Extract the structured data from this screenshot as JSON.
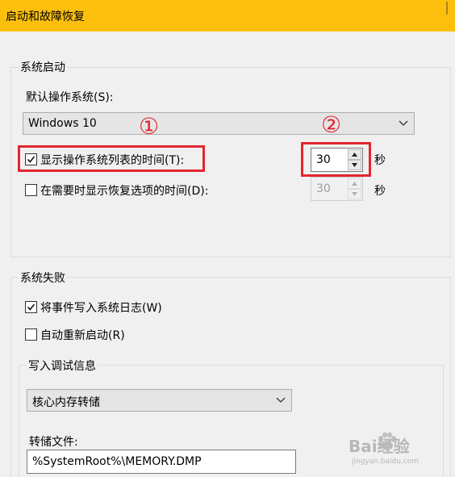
{
  "window": {
    "title": "启动和故障恢复"
  },
  "system_startup": {
    "group_label": "系统启动",
    "default_os_label": "默认操作系统(S):",
    "default_os_value": "Windows 10",
    "show_os_list": {
      "label": "显示操作系统列表的时间(T):",
      "checked": true,
      "value": "30",
      "unit": "秒"
    },
    "show_recovery": {
      "label": "在需要时显示恢复选项的时间(D):",
      "checked": false,
      "value": "30",
      "unit": "秒",
      "enabled": false
    }
  },
  "system_failure": {
    "group_label": "系统失败",
    "write_event_log": {
      "label": "将事件写入系统日志(W)",
      "checked": true
    },
    "auto_restart": {
      "label": "自动重新启动(R)",
      "checked": false
    },
    "debug_info": {
      "group_label": "写入调试信息",
      "dump_type": "核心内存转储",
      "dump_file_label": "转储文件:",
      "dump_file_value": "%SystemRoot%\\MEMORY.DMP"
    }
  },
  "annotations": {
    "marker_1": "①",
    "marker_2": "②",
    "highlight_color": "#e3262d"
  },
  "watermark": {
    "text": "Bai经验",
    "subtext": "jingyan.baidu.com"
  },
  "colors": {
    "titlebar": "#fbbf0c",
    "dialog_bg": "#f0f0f0"
  }
}
